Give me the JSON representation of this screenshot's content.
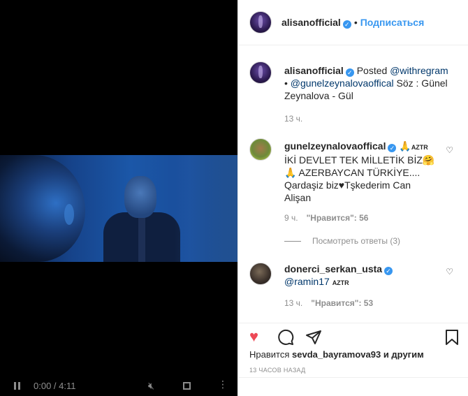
{
  "video": {
    "time": "0:00 / 4:11"
  },
  "header": {
    "username": "alisanofficial",
    "follow_label": "Подписаться",
    "more": "•••"
  },
  "caption": {
    "username": "alisanofficial",
    "posted": "Posted",
    "mention1": "@withregram",
    "mention2": "@gunelzeynalovaoffical",
    "text": " Söz : Günel Zeynalova - Gül",
    "time": "13 ч."
  },
  "comments": [
    {
      "username": "gunelzeynalovaoffical",
      "badge": "AZTR",
      "text_line1": "İKİ DEVLET TEK MİLLETİK BİZ",
      "text_line2": " AZERBAYCAN TÜRKİYE....",
      "text_line3": "Qardaşiz biz♥Tşkederim Can",
      "text_line4": "Alişan",
      "time": "9 ч.",
      "likes": "\"Нравится\": 56",
      "replies": "Посмотреть ответы (3)"
    },
    {
      "username": "donerci_serkan_usta",
      "mention": "@ramin17",
      "badge": "AZTR",
      "time": "13 ч.",
      "likes": "\"Нравится\": 53"
    }
  ],
  "likes_line": {
    "prefix": "Нравится",
    "user": "sevda_bayramova93",
    "suffix": "и другим"
  },
  "posted_ago": "13 ЧАСОВ НАЗАД",
  "colors": {
    "accent": "#3897f0",
    "like_red": "#ed4956",
    "muted": "#8e8e8e"
  }
}
